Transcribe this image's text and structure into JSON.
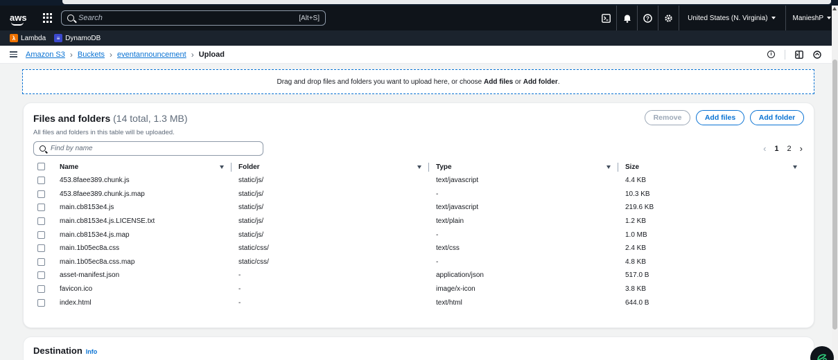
{
  "header": {
    "logo": "aws",
    "search_placeholder": "Search",
    "search_shortcut": "[Alt+S]",
    "region": "United States (N. Virginia)",
    "user": "ManieshP"
  },
  "favorites": [
    {
      "label": "Lambda",
      "color": "#ed7100"
    },
    {
      "label": "DynamoDB",
      "color": "#3b48cc"
    }
  ],
  "breadcrumb": {
    "items": [
      "Amazon S3",
      "Buckets",
      "eventannouncement"
    ],
    "current": "Upload"
  },
  "dropzone": {
    "text_before": "Drag and drop files and folders you want to upload here, or choose ",
    "add_files": "Add files",
    "or": " or ",
    "add_folder": "Add folder",
    "end": "."
  },
  "files_panel": {
    "title": "Files and folders",
    "count": "(14 total, 1.3 MB)",
    "subtitle": "All files and folders in this table will be uploaded.",
    "remove_label": "Remove",
    "add_files_label": "Add files",
    "add_folder_label": "Add folder",
    "find_placeholder": "Find by name",
    "pages": [
      "1",
      "2"
    ],
    "columns": [
      "Name",
      "Folder",
      "Type",
      "Size"
    ],
    "rows": [
      {
        "name": "453.8faee389.chunk.js",
        "folder": "static/js/",
        "type": "text/javascript",
        "size": "4.4 KB"
      },
      {
        "name": "453.8faee389.chunk.js.map",
        "folder": "static/js/",
        "type": "-",
        "size": "10.3 KB"
      },
      {
        "name": "main.cb8153e4.js",
        "folder": "static/js/",
        "type": "text/javascript",
        "size": "219.6 KB"
      },
      {
        "name": "main.cb8153e4.js.LICENSE.txt",
        "folder": "static/js/",
        "type": "text/plain",
        "size": "1.2 KB"
      },
      {
        "name": "main.cb8153e4.js.map",
        "folder": "static/js/",
        "type": "-",
        "size": "1.0 MB"
      },
      {
        "name": "main.1b05ec8a.css",
        "folder": "static/css/",
        "type": "text/css",
        "size": "2.4 KB"
      },
      {
        "name": "main.1b05ec8a.css.map",
        "folder": "static/css/",
        "type": "-",
        "size": "4.8 KB"
      },
      {
        "name": "asset-manifest.json",
        "folder": "-",
        "type": "application/json",
        "size": "517.0 B"
      },
      {
        "name": "favicon.ico",
        "folder": "-",
        "type": "image/x-icon",
        "size": "3.8 KB"
      },
      {
        "name": "index.html",
        "folder": "-",
        "type": "text/html",
        "size": "644.0 B"
      }
    ]
  },
  "destination": {
    "title": "Destination",
    "info": "Info"
  }
}
